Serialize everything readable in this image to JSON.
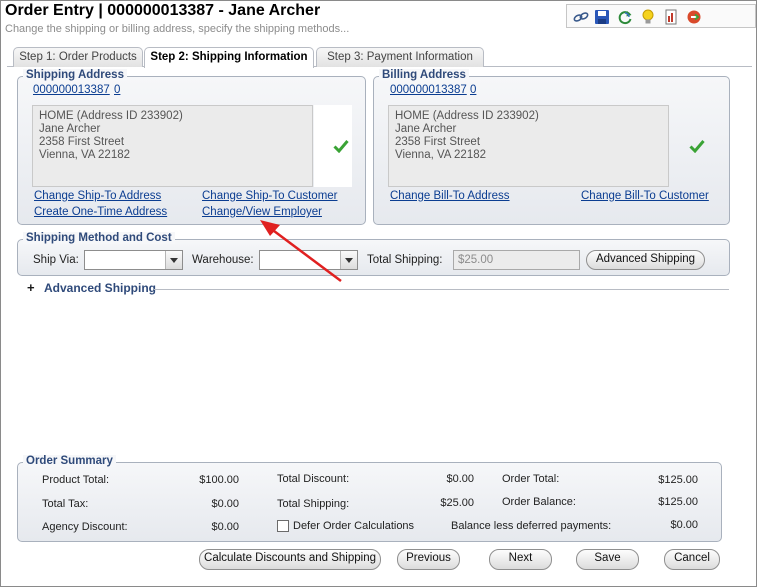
{
  "header": {
    "title": "Order Entry | 000000013387 - Jane Archer",
    "subtitle": "Change the shipping or billing address, specify the shipping methods..."
  },
  "toolbar": {
    "icons": [
      "link-icon",
      "save-icon",
      "refresh-icon",
      "lightbulb-icon",
      "report-icon",
      "close-record-icon"
    ]
  },
  "tabs": [
    {
      "label": "Step 1: Order Products",
      "active": false
    },
    {
      "label": "Step 2: Shipping Information",
      "active": true
    },
    {
      "label": "Step 3: Payment Information",
      "active": false
    }
  ],
  "shipping_address": {
    "legend": "Shipping Address",
    "customer_id": "000000013387",
    "count": "0",
    "lines": [
      "HOME (Address ID 233902)",
      "Jane Archer",
      "2358 First Street",
      "Vienna, VA 22182"
    ],
    "links": {
      "change_ship_to_address": "Change Ship-To Address",
      "change_ship_to_customer": "Change Ship-To Customer",
      "create_one_time_address": "Create One-Time Address",
      "change_view_employer": "Change/View Employer"
    }
  },
  "billing_address": {
    "legend": "Billing Address",
    "customer_id": "000000013387",
    "count": "0",
    "lines": [
      "HOME (Address ID 233902)",
      "Jane Archer",
      "2358 First Street",
      "Vienna, VA 22182"
    ],
    "links": {
      "change_bill_to_address": "Change Bill-To Address",
      "change_bill_to_customer": "Change Bill-To Customer"
    }
  },
  "shipping_method": {
    "legend": "Shipping Method and Cost",
    "ship_via_label": "Ship Via:",
    "ship_via_value": "",
    "warehouse_label": "Warehouse:",
    "warehouse_value": "",
    "total_shipping_label": "Total Shipping:",
    "total_shipping_value": "$25.00",
    "advanced_button": "Advanced Shipping"
  },
  "advanced_shipping": {
    "toggle": "+",
    "label": "Advanced Shipping"
  },
  "order_summary": {
    "legend": "Order Summary",
    "product_total_label": "Product Total:",
    "product_total": "$100.00",
    "total_discount_label": "Total Discount:",
    "total_discount": "$0.00",
    "order_total_label": "Order Total:",
    "order_total": "$125.00",
    "total_tax_label": "Total Tax:",
    "total_tax": "$0.00",
    "total_shipping_label": "Total Shipping:",
    "total_shipping": "$25.00",
    "order_balance_label": "Order Balance:",
    "order_balance": "$125.00",
    "agency_discount_label": "Agency Discount:",
    "agency_discount": "$0.00",
    "defer_label": "Defer Order Calculations",
    "defer_checked": false,
    "balance_less_deferred_label": "Balance less deferred payments:",
    "balance_less_deferred": "$0.00"
  },
  "footer_buttons": {
    "calculate": "Calculate Discounts and Shipping",
    "previous": "Previous",
    "next": "Next",
    "save": "Save",
    "cancel": "Cancel"
  },
  "colors": {
    "link": "#0b3d91",
    "legend": "#2f4a7a",
    "annotation_arrow": "#e02020",
    "check": "#3aa335"
  }
}
